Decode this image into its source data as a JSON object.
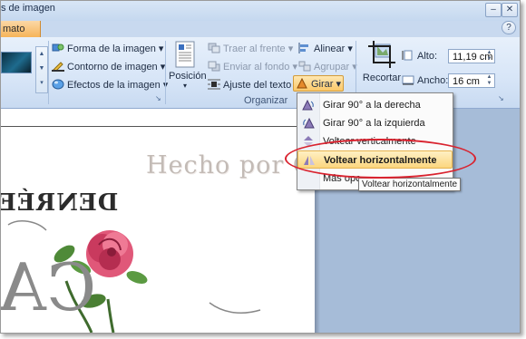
{
  "window": {
    "title_fragment": "s de imagen",
    "active_tab": "mato",
    "controls": {
      "minimize": "–",
      "close": "✕",
      "help": "?"
    }
  },
  "ribbon": {
    "styles": {
      "forma": "Forma de la imagen",
      "contorno": "Contorno de imagen",
      "efectos": "Efectos de la imagen"
    },
    "organizar": {
      "posicion": "Posición",
      "traer": "Traer al frente",
      "enviar": "Enviar al fondo",
      "ajuste": "Ajuste del texto",
      "alinear": "Alinear",
      "agrupar": "Agrupar",
      "girar": "Girar",
      "group_label": "Organizar"
    },
    "tamano": {
      "recortar": "Recortar",
      "alto_label": "Alto:",
      "alto_value": "11,19 cm",
      "ancho_label": "Ancho:",
      "ancho_value": "16 cm"
    }
  },
  "menu": {
    "items": [
      {
        "label": "Girar 90° a la derecha",
        "icon": "rotate-right-icon"
      },
      {
        "label": "Girar 90° a la izquierda",
        "icon": "rotate-left-icon"
      },
      {
        "label": "Voltear verticalmente",
        "icon": "flip-vertical-icon"
      },
      {
        "label": "Voltear horizontalmente",
        "icon": "flip-horizontal-icon"
      },
      {
        "label": "Más opc...",
        "icon": ""
      }
    ],
    "tooltip": "Voltear horizontalmente"
  },
  "document": {
    "watermark": "Hecho por Geles :)",
    "mirrored_line": "DENRÉE",
    "mirrored_large": "CA"
  },
  "colors": {
    "ribbon": "#d7e5f7",
    "accent_orange": "#fbc869",
    "annotation_red": "#d9232f",
    "rose": "#d8325a"
  }
}
